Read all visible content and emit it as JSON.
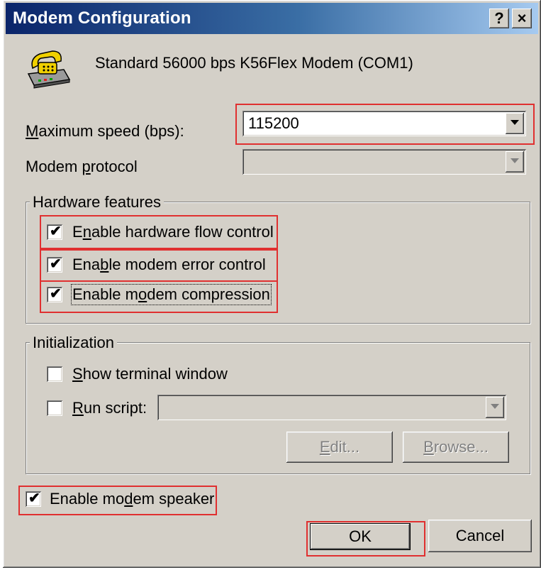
{
  "window": {
    "title": "Modem Configuration",
    "help_button": "?",
    "close_button": "×",
    "modem_icon": "telephone-modem-icon"
  },
  "header": {
    "modem_name": "Standard 56000 bps K56Flex Modem (COM1)"
  },
  "speed": {
    "label_pre": "",
    "label_mnemonic": "M",
    "label_post": "aximum speed (bps):",
    "value": "115200"
  },
  "protocol": {
    "label_pre": "Modem ",
    "label_mnemonic": "p",
    "label_post": "rotocol",
    "value": ""
  },
  "hardware": {
    "title": "Hardware features",
    "flow": {
      "pre": "E",
      "mn": "n",
      "post": "able hardware flow control",
      "checked": true
    },
    "error": {
      "pre": "Ena",
      "mn": "b",
      "post": "le modem error control",
      "checked": true
    },
    "compression": {
      "pre": "Enable m",
      "mn": "o",
      "post": "dem compression",
      "checked": true
    }
  },
  "init": {
    "title": "Initialization",
    "terminal": {
      "pre": "",
      "mn": "S",
      "post": "how terminal window",
      "checked": false
    },
    "script": {
      "pre": "",
      "mn": "R",
      "post": "un script:",
      "checked": false,
      "value": ""
    },
    "edit_button": {
      "pre": "",
      "mn": "E",
      "post": "dit..."
    },
    "browse_button": {
      "pre": "",
      "mn": "B",
      "post": "rowse..."
    }
  },
  "speaker": {
    "pre": "Enable mo",
    "mn": "d",
    "post": "em speaker",
    "checked": true
  },
  "buttons": {
    "ok": "OK",
    "cancel": "Cancel"
  },
  "colors": {
    "highlight": "#e03030",
    "title_gradient_start": "#0a246a",
    "face": "#d4d0c8"
  }
}
